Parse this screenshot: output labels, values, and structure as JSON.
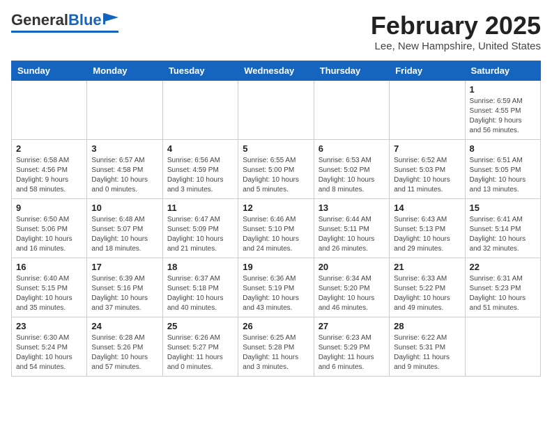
{
  "header": {
    "logo_general": "General",
    "logo_blue": "Blue",
    "title": "February 2025",
    "subtitle": "Lee, New Hampshire, United States"
  },
  "weekdays": [
    "Sunday",
    "Monday",
    "Tuesday",
    "Wednesday",
    "Thursday",
    "Friday",
    "Saturday"
  ],
  "weeks": [
    [
      {
        "day": "",
        "detail": ""
      },
      {
        "day": "",
        "detail": ""
      },
      {
        "day": "",
        "detail": ""
      },
      {
        "day": "",
        "detail": ""
      },
      {
        "day": "",
        "detail": ""
      },
      {
        "day": "",
        "detail": ""
      },
      {
        "day": "1",
        "detail": "Sunrise: 6:59 AM\nSunset: 4:55 PM\nDaylight: 9 hours\nand 56 minutes."
      }
    ],
    [
      {
        "day": "2",
        "detail": "Sunrise: 6:58 AM\nSunset: 4:56 PM\nDaylight: 9 hours\nand 58 minutes."
      },
      {
        "day": "3",
        "detail": "Sunrise: 6:57 AM\nSunset: 4:58 PM\nDaylight: 10 hours\nand 0 minutes."
      },
      {
        "day": "4",
        "detail": "Sunrise: 6:56 AM\nSunset: 4:59 PM\nDaylight: 10 hours\nand 3 minutes."
      },
      {
        "day": "5",
        "detail": "Sunrise: 6:55 AM\nSunset: 5:00 PM\nDaylight: 10 hours\nand 5 minutes."
      },
      {
        "day": "6",
        "detail": "Sunrise: 6:53 AM\nSunset: 5:02 PM\nDaylight: 10 hours\nand 8 minutes."
      },
      {
        "day": "7",
        "detail": "Sunrise: 6:52 AM\nSunset: 5:03 PM\nDaylight: 10 hours\nand 11 minutes."
      },
      {
        "day": "8",
        "detail": "Sunrise: 6:51 AM\nSunset: 5:05 PM\nDaylight: 10 hours\nand 13 minutes."
      }
    ],
    [
      {
        "day": "9",
        "detail": "Sunrise: 6:50 AM\nSunset: 5:06 PM\nDaylight: 10 hours\nand 16 minutes."
      },
      {
        "day": "10",
        "detail": "Sunrise: 6:48 AM\nSunset: 5:07 PM\nDaylight: 10 hours\nand 18 minutes."
      },
      {
        "day": "11",
        "detail": "Sunrise: 6:47 AM\nSunset: 5:09 PM\nDaylight: 10 hours\nand 21 minutes."
      },
      {
        "day": "12",
        "detail": "Sunrise: 6:46 AM\nSunset: 5:10 PM\nDaylight: 10 hours\nand 24 minutes."
      },
      {
        "day": "13",
        "detail": "Sunrise: 6:44 AM\nSunset: 5:11 PM\nDaylight: 10 hours\nand 26 minutes."
      },
      {
        "day": "14",
        "detail": "Sunrise: 6:43 AM\nSunset: 5:13 PM\nDaylight: 10 hours\nand 29 minutes."
      },
      {
        "day": "15",
        "detail": "Sunrise: 6:41 AM\nSunset: 5:14 PM\nDaylight: 10 hours\nand 32 minutes."
      }
    ],
    [
      {
        "day": "16",
        "detail": "Sunrise: 6:40 AM\nSunset: 5:15 PM\nDaylight: 10 hours\nand 35 minutes."
      },
      {
        "day": "17",
        "detail": "Sunrise: 6:39 AM\nSunset: 5:16 PM\nDaylight: 10 hours\nand 37 minutes."
      },
      {
        "day": "18",
        "detail": "Sunrise: 6:37 AM\nSunset: 5:18 PM\nDaylight: 10 hours\nand 40 minutes."
      },
      {
        "day": "19",
        "detail": "Sunrise: 6:36 AM\nSunset: 5:19 PM\nDaylight: 10 hours\nand 43 minutes."
      },
      {
        "day": "20",
        "detail": "Sunrise: 6:34 AM\nSunset: 5:20 PM\nDaylight: 10 hours\nand 46 minutes."
      },
      {
        "day": "21",
        "detail": "Sunrise: 6:33 AM\nSunset: 5:22 PM\nDaylight: 10 hours\nand 49 minutes."
      },
      {
        "day": "22",
        "detail": "Sunrise: 6:31 AM\nSunset: 5:23 PM\nDaylight: 10 hours\nand 51 minutes."
      }
    ],
    [
      {
        "day": "23",
        "detail": "Sunrise: 6:30 AM\nSunset: 5:24 PM\nDaylight: 10 hours\nand 54 minutes."
      },
      {
        "day": "24",
        "detail": "Sunrise: 6:28 AM\nSunset: 5:26 PM\nDaylight: 10 hours\nand 57 minutes."
      },
      {
        "day": "25",
        "detail": "Sunrise: 6:26 AM\nSunset: 5:27 PM\nDaylight: 11 hours\nand 0 minutes."
      },
      {
        "day": "26",
        "detail": "Sunrise: 6:25 AM\nSunset: 5:28 PM\nDaylight: 11 hours\nand 3 minutes."
      },
      {
        "day": "27",
        "detail": "Sunrise: 6:23 AM\nSunset: 5:29 PM\nDaylight: 11 hours\nand 6 minutes."
      },
      {
        "day": "28",
        "detail": "Sunrise: 6:22 AM\nSunset: 5:31 PM\nDaylight: 11 hours\nand 9 minutes."
      },
      {
        "day": "",
        "detail": ""
      }
    ]
  ]
}
